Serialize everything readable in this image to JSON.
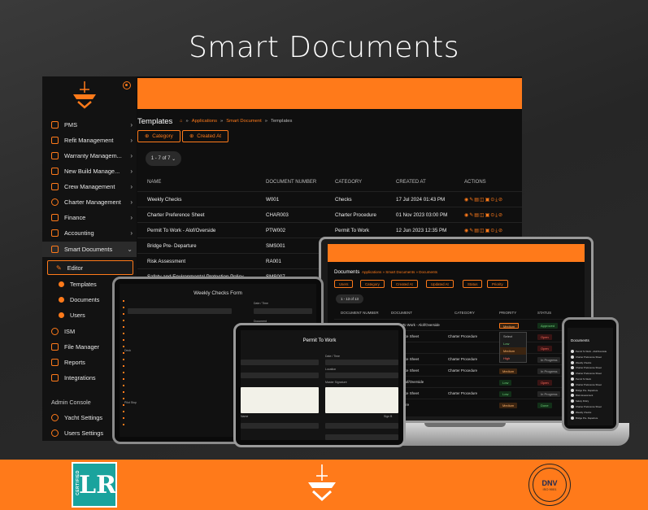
{
  "hero": {
    "title": "Smart Documents"
  },
  "sidebar": {
    "items": [
      {
        "label": "PMS"
      },
      {
        "label": "Refit Management"
      },
      {
        "label": "Warranty Managem..."
      },
      {
        "label": "New Build Manage..."
      },
      {
        "label": "Crew Management"
      },
      {
        "label": "Charter Management"
      },
      {
        "label": "Finance"
      },
      {
        "label": "Accounting"
      },
      {
        "label": "Smart Documents"
      },
      {
        "label": "Editor"
      },
      {
        "label": "Templates"
      },
      {
        "label": "Documents"
      },
      {
        "label": "Users"
      },
      {
        "label": "ISM"
      },
      {
        "label": "File Manager"
      },
      {
        "label": "Reports"
      },
      {
        "label": "Integrations"
      }
    ],
    "admin_label": "Admin Console",
    "admin_items": [
      {
        "label": "Yacht Settings"
      },
      {
        "label": "Users Settings"
      }
    ]
  },
  "main": {
    "title": "Templates",
    "breadcrumb": [
      "Applications",
      "Smart Document",
      "Templates"
    ],
    "filters": [
      "Category",
      "Created At"
    ],
    "pager": "1 - 7 of 7",
    "columns": [
      "NAME",
      "DOCUMENT NUMBER",
      "CATEGORY",
      "CREATED AT",
      "ACTIONS"
    ],
    "rows": [
      {
        "name": "Weekly Checks",
        "number": "W001",
        "category": "Checks",
        "created": "17 Jul 2024 01:43 PM"
      },
      {
        "name": "Charter Preference Sheet",
        "number": "CHAR003",
        "category": "Charter Procedure",
        "created": "01 Nov 2023 03:00 PM"
      },
      {
        "name": "Permit To Work - Alof/Overside",
        "number": "PTW002",
        "category": "Permit To Work",
        "created": "12 Jun 2023 12:35 PM"
      },
      {
        "name": "Bridge Pre- Departure",
        "number": "SMS001",
        "category": "",
        "created": ""
      },
      {
        "name": "Risk Assessment",
        "number": "RA001",
        "category": "",
        "created": ""
      },
      {
        "name": "Safety and Environmental Protection Policy",
        "number": "SMS007",
        "category": "",
        "created": ""
      }
    ]
  },
  "laptop": {
    "title": "Documents",
    "breadcrumb": "Applications » Smart Documents » Documents",
    "filters": [
      "Users",
      "Category",
      "Created At",
      "Updated At",
      "Status",
      "Priority"
    ],
    "pager": "1 - 13 of 13",
    "columns": [
      "DOCUMENT NUMBER",
      "DOCUMENT",
      "CATEGORY",
      "PRIORITY",
      "STATUS"
    ],
    "rows": [
      {
        "num": "PTW002",
        "doc": "Permit To Work - Alof/Overside",
        "cat": "",
        "pri": "Medium",
        "status": "Approved"
      },
      {
        "num": "",
        "doc": "Preference Sheet",
        "cat": "Charter Procedure",
        "pri": "",
        "status": "Open"
      },
      {
        "num": "",
        "doc": "Checks",
        "cat": "",
        "pri": "",
        "status": "Open"
      },
      {
        "num": "",
        "doc": "Preference Sheet",
        "cat": "Charter Procedure",
        "pri": "High",
        "status": "In Progress"
      },
      {
        "num": "",
        "doc": "Preference Sheet",
        "cat": "Charter Procedure",
        "pri": "Medium",
        "status": "In Progress"
      },
      {
        "num": "",
        "doc": "Work - Alof/Overside",
        "cat": "",
        "pri": "Low",
        "status": "Open"
      },
      {
        "num": "",
        "doc": "Preference Sheet",
        "cat": "Charter Procedure",
        "pri": "Low",
        "status": "In Progress"
      },
      {
        "num": "",
        "doc": "- Departure",
        "cat": "",
        "pri": "Medium",
        "status": "Done"
      }
    ],
    "priority_options": [
      "Select",
      "Low",
      "Medium",
      "High"
    ]
  },
  "tablet_left": {
    "title": "Weekly Checks Form",
    "labels": [
      "Date / Time",
      "Document",
      "Deck",
      "Pilot Stop"
    ]
  },
  "tablet_right": {
    "title": "Permit To Work",
    "labels": [
      "Date / Time",
      "Location",
      "Master Signature",
      "Name",
      "Sign B"
    ]
  },
  "phone": {
    "title": "Documents",
    "items": [
      "Permit To Work - Alof/Overside",
      "Charter Preference Sheet",
      "Weekly Checks",
      "Charter Preference Sheet",
      "Charter Preference Sheet",
      "Permit To Work",
      "Charter Preference Sheet",
      "Bridge Pre- Departure",
      "Risk Assessment",
      "Safety Policy",
      "Charter Preference Sheet",
      "Weekly Checks",
      "Bridge Pre- Departure"
    ]
  },
  "footer": {
    "lr_badge": "CERTIFIED",
    "lr_mark": "LR",
    "dnv_text": "DNV",
    "dnv_iso": "ISO 9001"
  },
  "colors": {
    "accent": "#ff7a1a",
    "background": "#2c2c2c"
  }
}
